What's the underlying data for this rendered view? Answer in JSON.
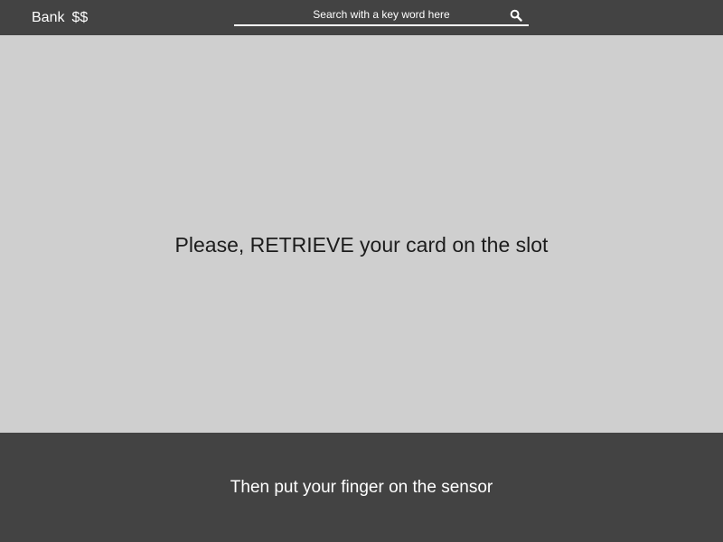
{
  "header": {
    "brand_name": "Bank",
    "brand_symbol": "$$",
    "search": {
      "placeholder": "Search with a key word here",
      "icon": "search-icon"
    }
  },
  "main": {
    "instruction": "Please, RETRIEVE your card on the slot"
  },
  "footer": {
    "instruction": "Then put your finger on the sensor"
  },
  "colors": {
    "bar_background": "#434343",
    "content_background": "#cfcfcf",
    "bar_text": "#ffffff",
    "content_text": "#1c1c1c"
  }
}
